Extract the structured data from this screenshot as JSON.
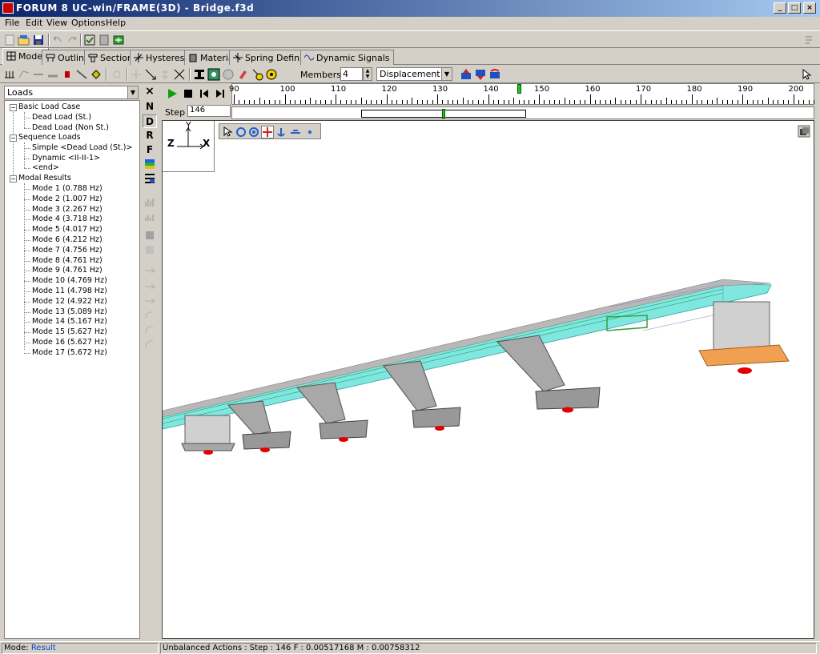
{
  "window": {
    "title": "FORUM 8   UC-win/FRAME(3D)  -  Bridge.f3d"
  },
  "menu": [
    "File",
    "Edit",
    "View",
    "Options",
    "Help"
  ],
  "tabs": [
    "Model",
    "Outline",
    "Section",
    "Hysteresis",
    "Material",
    "Spring Definition",
    "Dynamic Signals"
  ],
  "toolbar2": {
    "members_label": "Members N :",
    "members_value": "4",
    "result_type": "Displacement"
  },
  "left_panel": {
    "dropdown": "Loads",
    "tree": {
      "basic_load_case": {
        "label": "Basic Load Case",
        "children": [
          "Dead Load (St.)",
          "Dead Load (Non St.)"
        ]
      },
      "sequence_loads": {
        "label": "Sequence Loads",
        "children": [
          "Simple <Dead Load (St.)>",
          "Dynamic <II-II-1>",
          "<end>"
        ]
      },
      "modal_results": {
        "label": "Modal Results",
        "children": [
          "Mode 1 (0.788 Hz)",
          "Mode 2 (1.007 Hz)",
          "Mode 3 (2.267 Hz)",
          "Mode 4 (3.718 Hz)",
          "Mode 5 (4.017 Hz)",
          "Mode 6 (4.212 Hz)",
          "Mode 7 (4.756 Hz)",
          "Mode 8 (4.761 Hz)",
          "Mode 9 (4.761 Hz)",
          "Mode 10 (4.769 Hz)",
          "Mode 11 (4.798 Hz)",
          "Mode 12 (4.922 Hz)",
          "Mode 13 (5.089 Hz)",
          "Mode 14 (5.167 Hz)",
          "Mode 15 (5.627 Hz)",
          "Mode 16 (5.627 Hz)",
          "Mode 17 (5.672 Hz)"
        ]
      }
    }
  },
  "side_toolbar": {
    "close": "×",
    "letters": [
      "N",
      "D",
      "R",
      "F"
    ]
  },
  "player": {
    "step_label": "Step :",
    "step_value": "146"
  },
  "ruler": {
    "labels": [
      "90",
      "100",
      "110",
      "120",
      "130",
      "140",
      "150",
      "160",
      "170",
      "180",
      "190",
      "200"
    ],
    "current_step": 146
  },
  "viewport": {
    "axis_y": "Y",
    "axis_z": "Z",
    "axis_x": "X"
  },
  "status": {
    "mode_label": "Mode:",
    "mode_value": "Result",
    "message": "Unbalanced Actions : Step : 146  F : 0.00517168  M : 0.00758312"
  },
  "colors": {
    "deck": "#7fe7e0",
    "pier": "#a8a8a8",
    "bearing": "#e00000",
    "abutment_footing": "#f0a050"
  }
}
